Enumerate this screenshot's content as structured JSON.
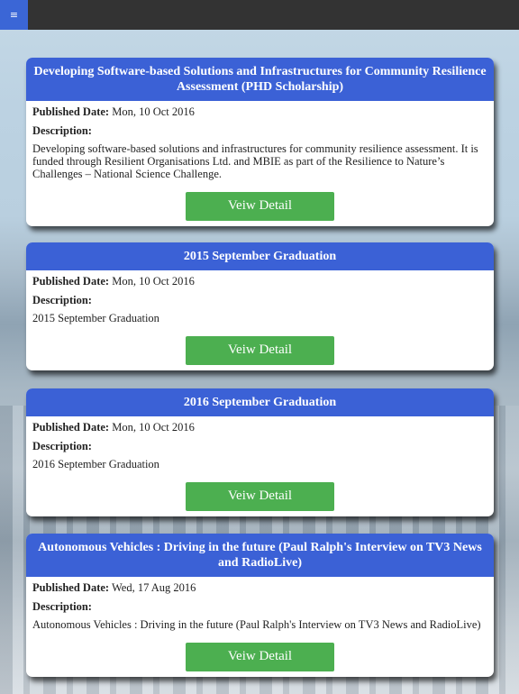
{
  "topbar": {
    "menu_icon": "≡"
  },
  "labels": {
    "published": "Published Date:",
    "description": "Description:"
  },
  "cards": [
    {
      "title": "Developing Software-based Solutions and Infrastructures for Community Resilience Assessment (PHD Scholarship)",
      "date": "Mon, 10 Oct 2016",
      "description": "Developing software-based solutions and infrastructures for community resilience assessment. It is funded through Resilient Organisations Ltd. and MBIE as part of the Resilience to Nature’s Challenges – National Science Challenge.",
      "button": "Veiw Detail"
    },
    {
      "title": "2015 September Graduation",
      "date": "Mon, 10 Oct 2016",
      "description": "2015 September Graduation",
      "button": "Veiw Detail"
    },
    {
      "title": "2016 September Graduation",
      "date": "Mon, 10 Oct 2016",
      "description": "2016 September Graduation",
      "button": "Veiw Detail"
    },
    {
      "title": "Autonomous Vehicles : Driving in the future (Paul Ralph's Interview on TV3 News and RadioLive)",
      "date": "Wed, 17 Aug 2016",
      "description": "Autonomous Vehicles : Driving in the future (Paul Ralph's Interview on TV3 News and RadioLive)",
      "button": "Veiw Detail"
    }
  ]
}
